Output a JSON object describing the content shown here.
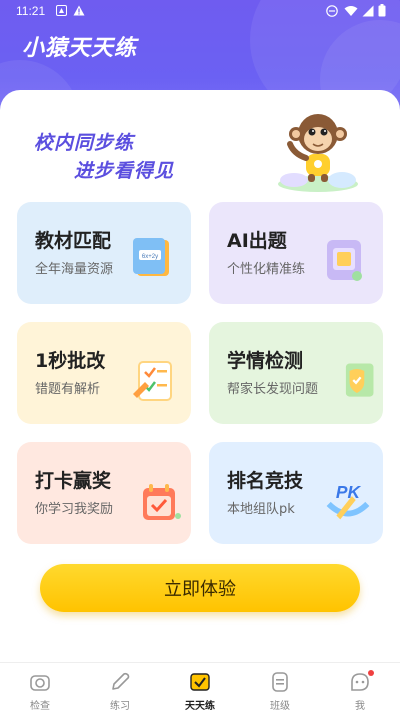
{
  "status_bar": {
    "time": "11:21"
  },
  "app": {
    "title": "小猿天天练"
  },
  "banner": {
    "line1": "校内同步练",
    "line2": "进步看得见"
  },
  "cards": [
    {
      "title": "教材匹配",
      "subtitle": "全年海量资源",
      "bg": "#dfeefb",
      "art_label": "6x+2y"
    },
    {
      "title": "AI出题",
      "subtitle": "个性化精准练",
      "bg": "#ebe6fb"
    },
    {
      "title": "1秒批改",
      "subtitle": "错题有解析",
      "bg": "#fff4d8"
    },
    {
      "title": "学情检测",
      "subtitle": "帮家长发现问题",
      "bg": "#e5f5de"
    },
    {
      "title": "打卡赢奖",
      "subtitle": "你学习我奖励",
      "bg": "#ffe8e0"
    },
    {
      "title": "排名竞技",
      "subtitle": "本地组队pk",
      "bg": "#e1efff",
      "art_label": "PK"
    }
  ],
  "cta": {
    "label": "立即体验"
  },
  "tabs": [
    {
      "label": "检查",
      "icon": "camera-icon"
    },
    {
      "label": "练习",
      "icon": "pencil-icon"
    },
    {
      "label": "天天练",
      "icon": "checkbook-icon",
      "active": true
    },
    {
      "label": "班级",
      "icon": "class-icon"
    },
    {
      "label": "我",
      "icon": "profile-icon",
      "badge": true
    }
  ],
  "colors": {
    "brand_purple": "#6b61f3",
    "cta_yellow": "#ffc300",
    "slogan_purple": "#5b4fdf"
  }
}
